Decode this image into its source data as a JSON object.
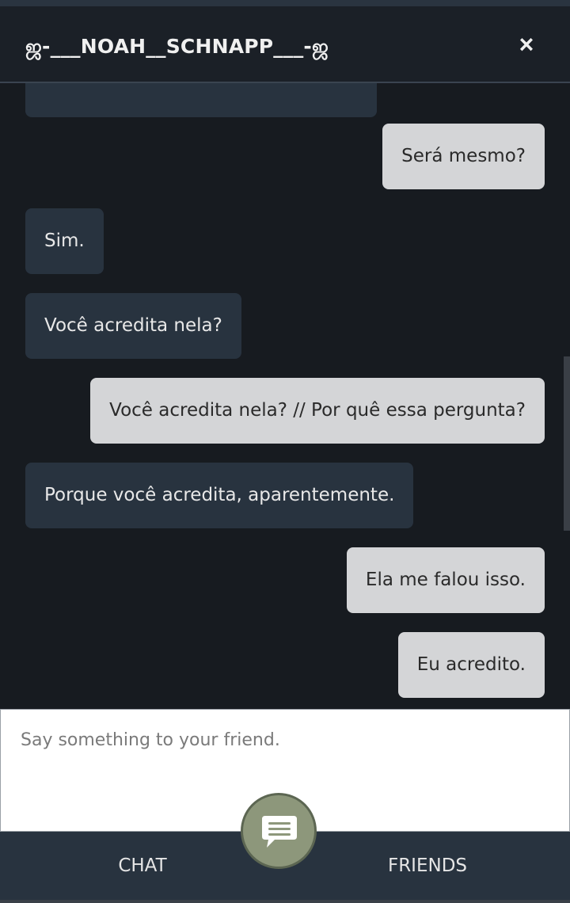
{
  "header": {
    "title": "ஜ-___NOAH__SCHNAPP___-ஜ",
    "close_label": "×"
  },
  "messages": [
    {
      "from": "friend",
      "text": "Será mesmo?",
      "side": "sent"
    },
    {
      "from": "me",
      "text": "Sim.",
      "side": "recv"
    },
    {
      "from": "me",
      "text": "Você acredita nela?",
      "side": "recv"
    },
    {
      "from": "friend",
      "text": "Você acredita nela? // Por quê essa pergunta?",
      "side": "sent"
    },
    {
      "from": "me",
      "text": "Porque você acredita, aparentemente.",
      "side": "recv"
    },
    {
      "from": "friend",
      "text": "Ela me falou isso.",
      "side": "sent"
    },
    {
      "from": "friend",
      "text": "Eu acredito.",
      "side": "sent"
    }
  ],
  "composer": {
    "placeholder": "Say something to your friend."
  },
  "nav": {
    "chat_label": "CHAT",
    "friends_label": "FRIENDS",
    "fab_icon": "chat-bubble-icon"
  },
  "colors": {
    "background": "#171b20",
    "received_bubble": "#28333f",
    "sent_bubble": "#d4d5d7",
    "fab": "#8d977b"
  }
}
